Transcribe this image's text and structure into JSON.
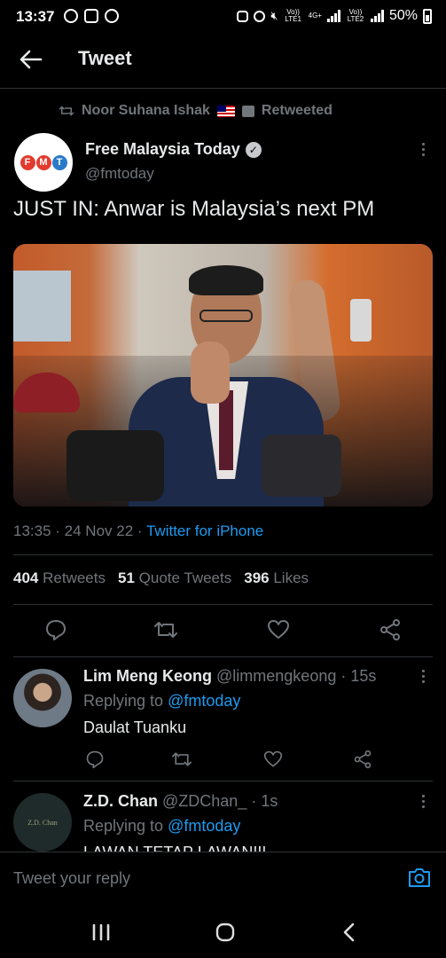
{
  "status_bar": {
    "time": "13:37",
    "net1": "Vo)) LTE1",
    "net2": "4G+",
    "net3": "Vo)) LTE2",
    "battery": "50%"
  },
  "header": {
    "title": "Tweet"
  },
  "retweet": {
    "by": "Noor Suhana Ishak",
    "label": "Retweeted"
  },
  "tweet": {
    "avatar_text": [
      "F",
      "M",
      "T"
    ],
    "avatar_colors": [
      "#e23b2e",
      "#e23b2e",
      "#2a7ac8"
    ],
    "author": "Free Malaysia Today",
    "handle": "@fmtoday",
    "text": "JUST IN: Anwar is Malaysia’s next PM",
    "time": "13:35",
    "date": "24 Nov 22",
    "source": "Twitter for iPhone",
    "retweets_count": "404",
    "retweets_label": "Retweets",
    "quotes_count": "51",
    "quotes_label": "Quote Tweets",
    "likes_count": "396",
    "likes_label": "Likes"
  },
  "replies": [
    {
      "name": "Lim Meng Keong",
      "handle": "@limmengkeong",
      "time": "15s",
      "replying_label": "Replying to",
      "replying_to": "@fmtoday",
      "text": "Daulat Tuanku"
    },
    {
      "name": "Z.D. Chan",
      "handle": "@ZDChan_",
      "time": "1s",
      "replying_label": "Replying to",
      "replying_to": "@fmtoday",
      "avatar_text": "Z.D. Chan",
      "text": "LAWAN TETAP LAWAN!!!"
    }
  ],
  "composer": {
    "placeholder": "Tweet your reply"
  },
  "colors": {
    "accent": "#1d9bf0",
    "muted": "#71767b",
    "background": "#000000"
  }
}
